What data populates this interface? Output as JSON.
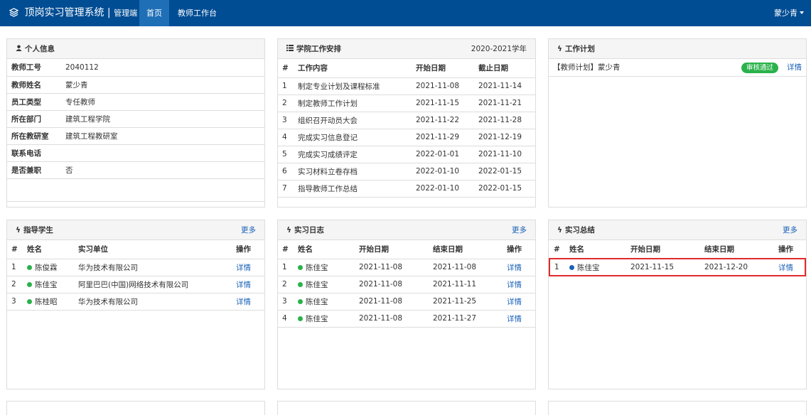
{
  "navbar": {
    "brand_title": "顶岗实习管理系统",
    "brand_sub": "管理端",
    "tabs": [
      "首页",
      "教师工作台"
    ],
    "user": "蒙少青"
  },
  "personal_info": {
    "title": "个人信息",
    "rows": [
      {
        "key": "教师工号",
        "value": "2040112"
      },
      {
        "key": "教师姓名",
        "value": "蒙少青"
      },
      {
        "key": "员工类型",
        "value": "专任教师"
      },
      {
        "key": "所在部门",
        "value": "建筑工程学院"
      },
      {
        "key": "所在教研室",
        "value": "建筑工程教研室"
      },
      {
        "key": "联系电话",
        "value": ""
      },
      {
        "key": "是否兼职",
        "value": "否"
      }
    ]
  },
  "college_schedule": {
    "title": "学院工作安排",
    "year": "2020-2021学年",
    "columns": [
      "#",
      "工作内容",
      "开始日期",
      "截止日期"
    ],
    "rows": [
      [
        "1",
        "制定专业计划及课程标准",
        "2021-11-08",
        "2021-11-14"
      ],
      [
        "2",
        "制定教师工作计划",
        "2021-11-15",
        "2021-11-21"
      ],
      [
        "3",
        "组织召开动员大会",
        "2021-11-22",
        "2021-11-28"
      ],
      [
        "4",
        "完成实习信息登记",
        "2021-11-29",
        "2021-12-19"
      ],
      [
        "5",
        "完成实习成绩评定",
        "2022-01-01",
        "2021-11-10"
      ],
      [
        "6",
        "实习材料立卷存档",
        "2022-01-10",
        "2022-01-15"
      ],
      [
        "7",
        "指导教师工作总结",
        "2022-01-10",
        "2022-01-15"
      ]
    ]
  },
  "work_plan": {
    "title": "工作计划",
    "item": "【教师计划】蒙少青",
    "status": "审核通过",
    "detail": "详情"
  },
  "students": {
    "title": "指导学生",
    "more": "更多",
    "columns": [
      "#",
      "姓名",
      "实习单位",
      "操作"
    ],
    "rows": [
      {
        "no": "1",
        "name": "陈俊霖",
        "company": "华为技术有限公司",
        "op": "详情"
      },
      {
        "no": "2",
        "name": "陈佳宝",
        "company": "阿里巴巴(中国)网络技术有限公司",
        "op": "详情"
      },
      {
        "no": "3",
        "name": "陈桂昭",
        "company": "华为技术有限公司",
        "op": "详情"
      }
    ]
  },
  "logs": {
    "title": "实习日志",
    "more": "更多",
    "columns": [
      "#",
      "姓名",
      "开始日期",
      "结束日期",
      "操作"
    ],
    "rows": [
      {
        "no": "1",
        "name": "陈佳宝",
        "start": "2021-11-08",
        "end": "2021-11-08",
        "op": "详情"
      },
      {
        "no": "2",
        "name": "陈佳宝",
        "start": "2021-11-08",
        "end": "2021-11-11",
        "op": "详情"
      },
      {
        "no": "3",
        "name": "陈佳宝",
        "start": "2021-11-08",
        "end": "2021-11-25",
        "op": "详情"
      },
      {
        "no": "4",
        "name": "陈佳宝",
        "start": "2021-11-08",
        "end": "2021-11-27",
        "op": "详情"
      }
    ]
  },
  "summary": {
    "title": "实习总结",
    "more": "更多",
    "columns": [
      "#",
      "姓名",
      "开始日期",
      "结束日期",
      "操作"
    ],
    "rows": [
      {
        "no": "1",
        "name": "陈佳宝",
        "start": "2021-11-15",
        "end": "2021-12-20",
        "op": "详情"
      }
    ]
  },
  "colors": {
    "navbar": "#004d94",
    "active_tab": "#1f6fb7",
    "link": "#1a62b8",
    "green_dot": "#2ab24a",
    "blue_dot": "#1a62b8",
    "highlight": "#e02a2a"
  }
}
